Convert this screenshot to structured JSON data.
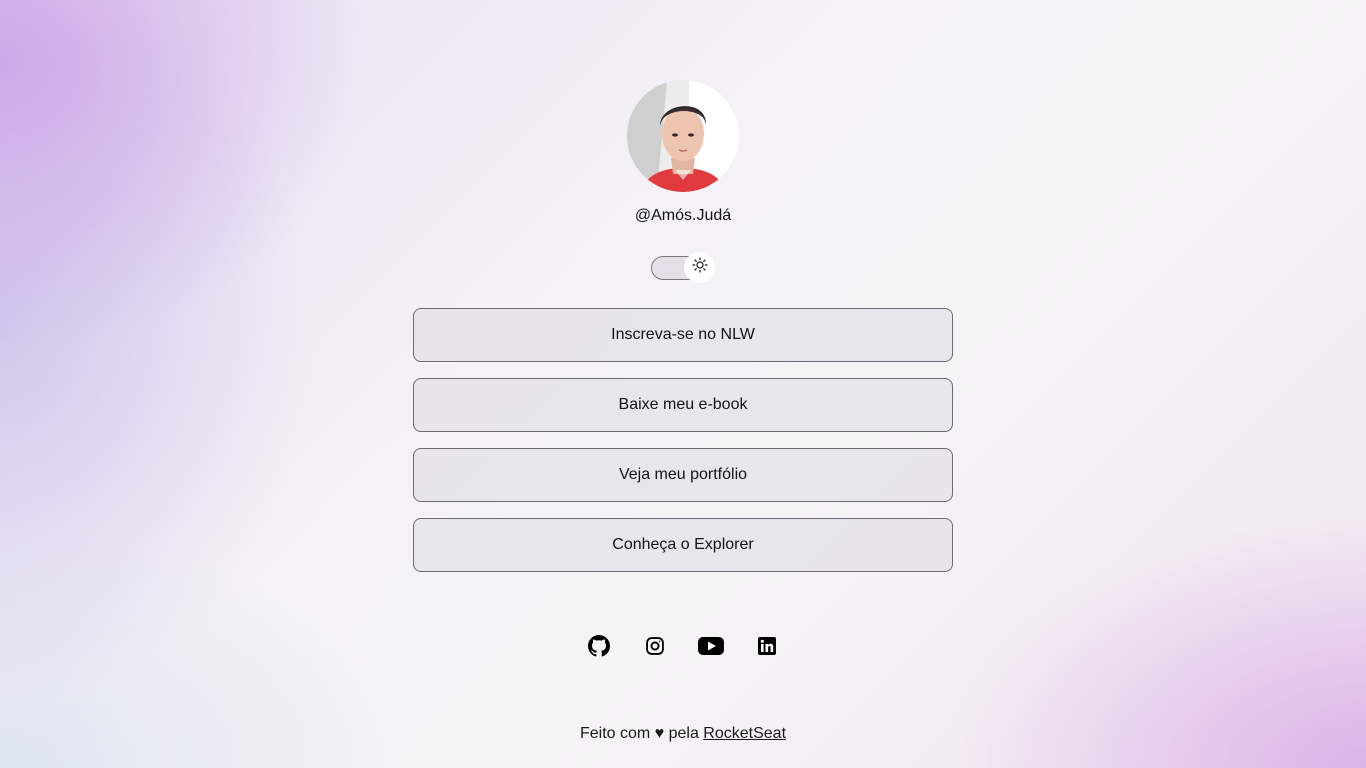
{
  "profile": {
    "username": "@Amós.Judá",
    "avatar_alt": "avatar"
  },
  "theme_toggle": {
    "icon": "sun-icon",
    "state": "light"
  },
  "links": [
    {
      "label": "Inscreva-se no NLW"
    },
    {
      "label": "Baixe meu e-book"
    },
    {
      "label": "Veja meu portfólio"
    },
    {
      "label": "Conheça o Explorer"
    }
  ],
  "social": [
    {
      "icon": "github-icon"
    },
    {
      "icon": "instagram-icon"
    },
    {
      "icon": "youtube-icon"
    },
    {
      "icon": "linkedin-icon"
    }
  ],
  "footer": {
    "prefix": "Feito com ♥ pela ",
    "brand": "RocketSeat"
  },
  "colors": {
    "accent_purple": "#c8a0e6",
    "text": "#1a1a1a",
    "button_border": "#6e6a73"
  }
}
